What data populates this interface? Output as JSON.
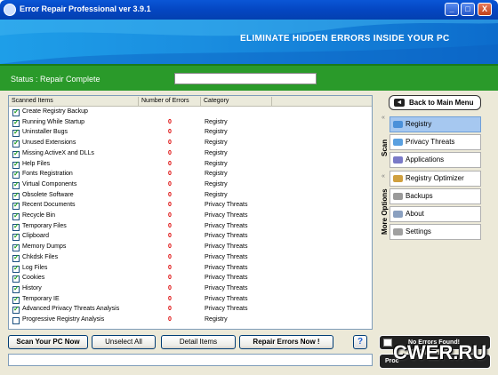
{
  "window": {
    "title": "Error Repair Professional ver 3.9.1",
    "controls": {
      "minimize": "_",
      "maximize": "□",
      "close": "X"
    }
  },
  "banner": {
    "text": "ELIMINATE HIDDEN ERRORS INSIDE YOUR PC"
  },
  "status": {
    "text": "Status : Repair Complete",
    "field_value": ""
  },
  "list": {
    "columns": [
      "Scanned Items",
      "Number of Errors",
      "Category"
    ],
    "rows": [
      {
        "checked": true,
        "name": "Create Registry Backup",
        "errors": "",
        "category": ""
      },
      {
        "checked": true,
        "name": "Running While Startup",
        "errors": "0",
        "category": "Registry"
      },
      {
        "checked": true,
        "name": "Uninstaller Bugs",
        "errors": "0",
        "category": "Registry"
      },
      {
        "checked": true,
        "name": "Unused Extensions",
        "errors": "0",
        "category": "Registry"
      },
      {
        "checked": true,
        "name": "Missing ActiveX and DLLs",
        "errors": "0",
        "category": "Registry"
      },
      {
        "checked": true,
        "name": "Help Files",
        "errors": "0",
        "category": "Registry"
      },
      {
        "checked": true,
        "name": "Fonts Registration",
        "errors": "0",
        "category": "Registry"
      },
      {
        "checked": true,
        "name": "Virtual Components",
        "errors": "0",
        "category": "Registry"
      },
      {
        "checked": true,
        "name": "Obsolete Software",
        "errors": "0",
        "category": "Registry"
      },
      {
        "checked": true,
        "name": "Recent Documents",
        "errors": "0",
        "category": "Privacy Threats"
      },
      {
        "checked": true,
        "name": "Recycle Bin",
        "errors": "0",
        "category": "Privacy Threats"
      },
      {
        "checked": true,
        "name": "Temporary Files",
        "errors": "0",
        "category": "Privacy Threats"
      },
      {
        "checked": true,
        "name": "Clipboard",
        "errors": "0",
        "category": "Privacy Threats"
      },
      {
        "checked": true,
        "name": "Memory Dumps",
        "errors": "0",
        "category": "Privacy Threats"
      },
      {
        "checked": true,
        "name": "Chkdsk Files",
        "errors": "0",
        "category": "Privacy Threats"
      },
      {
        "checked": true,
        "name": "Log Files",
        "errors": "0",
        "category": "Privacy Threats"
      },
      {
        "checked": true,
        "name": "Cookies",
        "errors": "0",
        "category": "Privacy Threats"
      },
      {
        "checked": true,
        "name": "History",
        "errors": "0",
        "category": "Privacy Threats"
      },
      {
        "checked": true,
        "name": "Temporary IE",
        "errors": "0",
        "category": "Privacy Threats"
      },
      {
        "checked": true,
        "name": "Advanced Privacy Threats Analysis",
        "errors": "0",
        "category": "Privacy Threats"
      },
      {
        "checked": false,
        "name": "Progressive Registry Analysis",
        "errors": "0",
        "category": "Registry"
      }
    ]
  },
  "buttons": {
    "scan": "Scan Your PC Now",
    "unselect": "Unselect All",
    "detail": "Detail Items",
    "repair": "Repair Errors Now !",
    "help": "?"
  },
  "bottom_field": {
    "value": ""
  },
  "sidebar": {
    "back": "Back to Main Menu",
    "scan_label": "Scan",
    "more_label": "More Options",
    "scan_items": [
      {
        "label": "Registry",
        "icon": "registry-icon",
        "active": true
      },
      {
        "label": "Privacy Threats",
        "icon": "privacy-icon",
        "active": false
      },
      {
        "label": "Applications",
        "icon": "applications-icon",
        "active": false
      }
    ],
    "more_items": [
      {
        "label": "Registry Optimizer",
        "icon": "optimizer-icon"
      },
      {
        "label": "Backups",
        "icon": "backups-icon"
      },
      {
        "label": "About",
        "icon": "about-icon"
      },
      {
        "label": "Settings",
        "icon": "settings-icon"
      }
    ]
  },
  "indicators": {
    "no_errors": "No Errors Found!",
    "process": "Proc"
  },
  "watermark": "CWER.RU",
  "colors": {
    "titlebar": "#0446c2",
    "banner": "#1a8ee0",
    "status_bar": "#2a9a2a",
    "error_count": "#dd0000",
    "active_item": "#a6c8f0"
  }
}
